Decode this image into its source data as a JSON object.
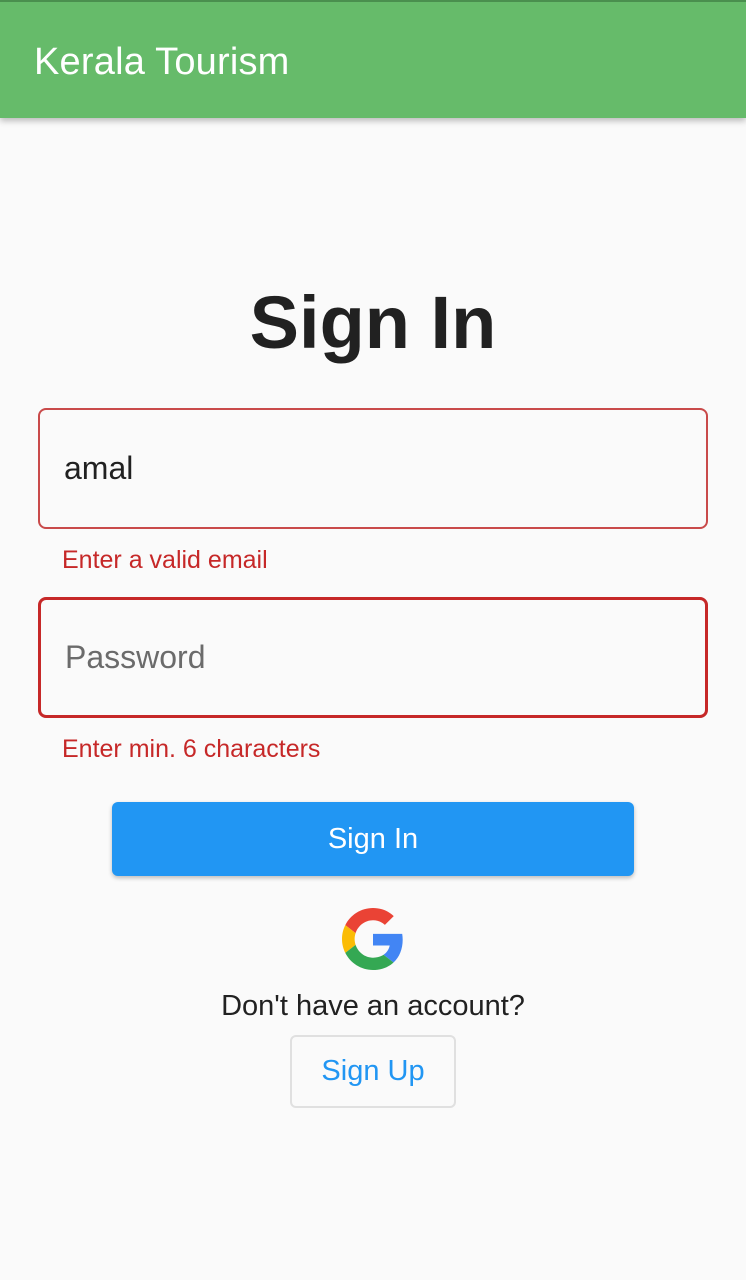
{
  "appbar": {
    "title": "Kerala Tourism",
    "color": "#66bb6a"
  },
  "page": {
    "title": "Sign In"
  },
  "form": {
    "email": {
      "value": "amal",
      "error": "Enter a valid email"
    },
    "password": {
      "placeholder": "Password",
      "error": "Enter min. 6 characters"
    },
    "signin_label": "Sign In",
    "signin_color": "#2196f3",
    "error_color": "#c62828"
  },
  "social": {
    "icon": "google-icon"
  },
  "signup": {
    "prompt": "Don't have an account?",
    "label": "Sign Up"
  }
}
